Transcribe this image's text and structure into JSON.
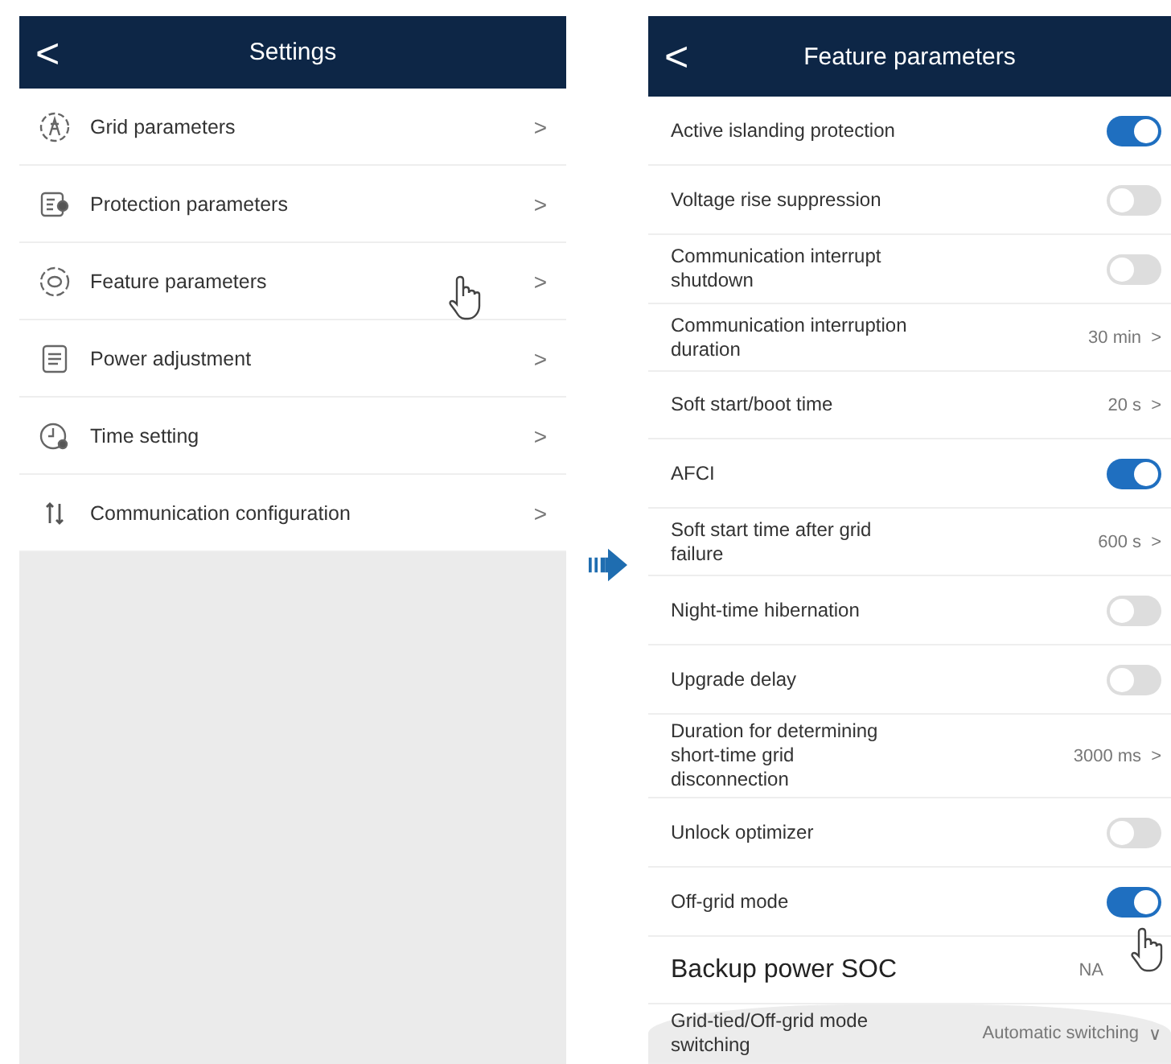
{
  "settings_screen": {
    "back_glyph": "<",
    "title": "Settings",
    "items": [
      {
        "label": "Grid parameters",
        "chevron": ">"
      },
      {
        "label": "Protection parameters",
        "chevron": ">"
      },
      {
        "label": "Feature parameters",
        "chevron": ">"
      },
      {
        "label": "Power adjustment",
        "chevron": ">"
      },
      {
        "label": "Time setting",
        "chevron": ">"
      },
      {
        "label": "Communication configuration",
        "chevron": ">"
      }
    ]
  },
  "feature_screen": {
    "back_glyph": "<",
    "title": "Feature parameters",
    "rows": [
      {
        "kind": "toggle",
        "label": "Active islanding protection",
        "on": true
      },
      {
        "kind": "toggle",
        "label": "Voltage rise suppression",
        "on": false
      },
      {
        "kind": "toggle",
        "label": "Communication interrupt shutdown",
        "on": false
      },
      {
        "kind": "value",
        "label": "Communication interruption duration",
        "value": "30 min",
        "chevron": ">"
      },
      {
        "kind": "value",
        "label": "Soft start/boot time",
        "value": "20 s",
        "chevron": ">"
      },
      {
        "kind": "toggle",
        "label": "AFCI",
        "on": true
      },
      {
        "kind": "value",
        "label": "Soft start time after grid failure",
        "value": "600 s",
        "chevron": ">"
      },
      {
        "kind": "toggle",
        "label": "Night-time hibernation",
        "on": false
      },
      {
        "kind": "toggle",
        "label": "Upgrade delay",
        "on": false
      },
      {
        "kind": "value",
        "label": "Duration for determining short-time grid disconnection",
        "value": "3000 ms",
        "chevron": ">"
      },
      {
        "kind": "toggle",
        "label": "Unlock optimizer",
        "on": false
      },
      {
        "kind": "toggle",
        "label": "Off-grid mode",
        "on": true
      },
      {
        "kind": "heading",
        "label": "Backup power SOC",
        "value": "NA"
      },
      {
        "kind": "dropdown",
        "label": "Grid-tied/Off-grid mode switching",
        "value": "Automatic switching",
        "chevron": "∨"
      }
    ]
  }
}
